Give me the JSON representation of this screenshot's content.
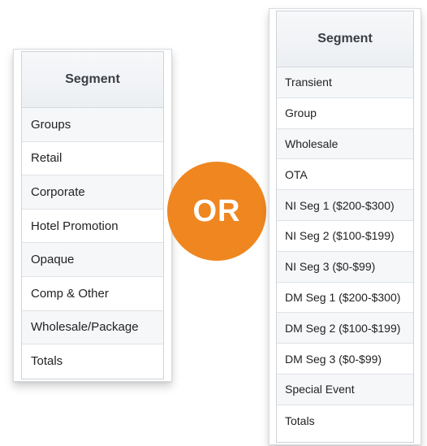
{
  "left_table": {
    "header": "Segment",
    "rows": [
      "Groups",
      "Retail",
      "Corporate",
      "Hotel Promotion",
      "Opaque",
      "Comp & Other",
      "Wholesale/Package",
      "Totals"
    ]
  },
  "or_badge": {
    "label": "OR",
    "color": "#ef8620"
  },
  "right_table": {
    "header": "Segment",
    "rows": [
      "Transient",
      "Group",
      "Wholesale",
      "OTA",
      "NI Seg 1 ($200-$300)",
      "NI Seg 2 ($100-$199)",
      "NI Seg 3 ($0-$99)",
      "DM Seg 1 ($200-$300)",
      "DM Seg 2 ($100-$199)",
      "DM Seg 3 ($0-$99)",
      "Special Event",
      "Totals"
    ]
  }
}
